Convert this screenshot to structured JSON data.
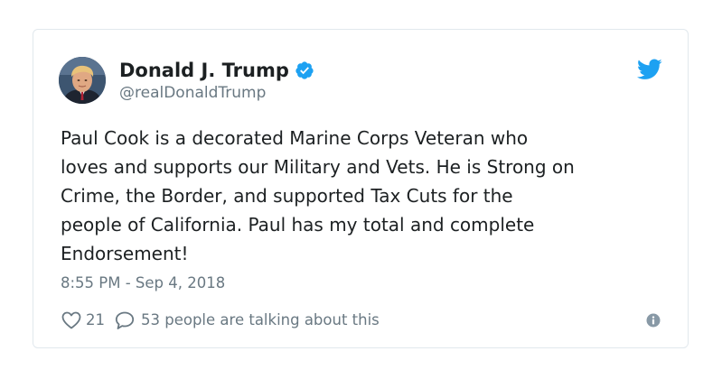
{
  "tweet": {
    "author": {
      "display_name": "Donald J. Trump",
      "handle": "@realDonaldTrump",
      "verified": true
    },
    "text": "Paul Cook is a decorated Marine Corps Veteran who\nloves and supports our Military and Vets. He is Strong on\nCrime, the Border, and supported Tax Cuts for the\npeople of California. Paul has my total and complete\nEndorsement!",
    "timestamp": "8:55 PM - Sep 4, 2018",
    "likes": "21",
    "talking": "53 people are talking about this"
  },
  "icons": {
    "brand": "twitter-bird-icon",
    "verified": "verified-badge-icon",
    "like": "heart-icon",
    "reply": "speech-bubble-icon",
    "info": "info-icon"
  },
  "colors": {
    "twitter_blue": "#1da1f2",
    "text": "#1c2022",
    "muted": "#697882",
    "border": "#e1e8ed"
  }
}
